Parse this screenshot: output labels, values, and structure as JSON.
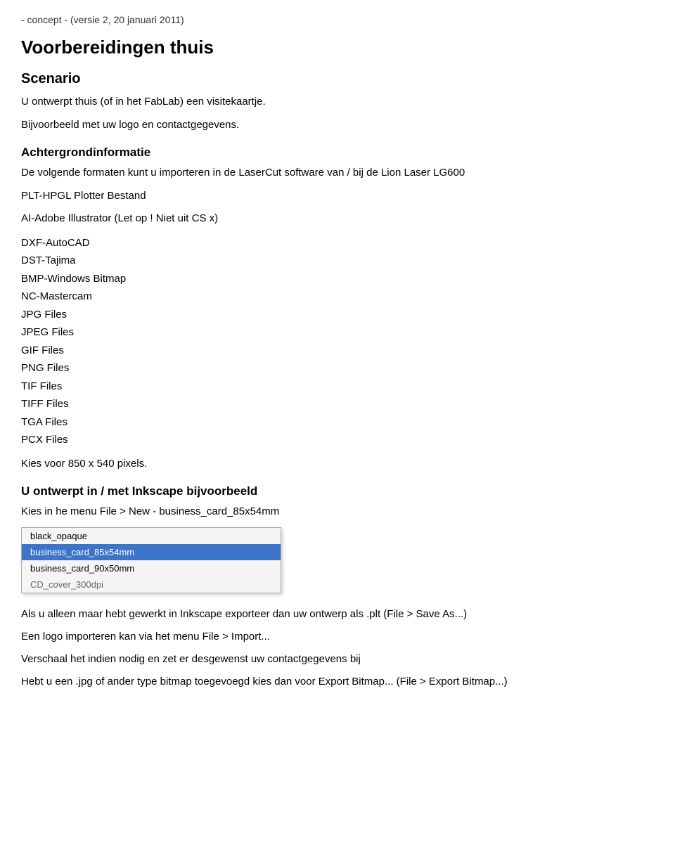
{
  "version_line": "- concept - (versie 2, 20 januari 2011)",
  "main_heading": "Voorbereidingen thuis",
  "scenario_heading": "Scenario",
  "scenario_text": "U ontwerpt thuis (of in het FabLab) een visitekaartje.",
  "scenario_subtext": "Bijvoorbeeld met uw logo en contactgegevens.",
  "background_heading": "Achtergrondinformatie",
  "background_intro": "De volgende formaten kunt u importeren in de LaserCut software van / bij de Lion Laser LG600",
  "plt_hpgl": "PLT-HPGL Plotter Bestand",
  "ai_adobe": "AI-Adobe Illustrator (Let op !",
  "ai_note": "Niet uit CS x)",
  "formats": [
    "DXF-AutoCAD",
    "DST-Tajima",
    "BMP-Windows Bitmap",
    "NC-Mastercam",
    "JPG Files",
    "JPEG Files",
    "GIF Files",
    "PNG Files",
    "TIF Files",
    "TIFF Files",
    "TGA Files",
    "PCX Files"
  ],
  "pixels_note": "Kies voor 850 x 540 pixels.",
  "inkscape_heading": "U ontwerpt in / met Inkscape bijvoorbeeld",
  "inkscape_menu_label": "Kies in he menu File > New - business_card_85x54mm",
  "menu_items": [
    {
      "label": "black_opaque",
      "selected": false
    },
    {
      "label": "business_card_85x54mm",
      "selected": true
    },
    {
      "label": "business_card_90x50mm",
      "selected": false
    },
    {
      "label": "CD_cover_300dpi",
      "selected": false,
      "partial": true
    }
  ],
  "export_note": "Als u alleen maar hebt gewerkt in Inkscape exporteer dan uw ontwerp als .plt (File > Save As...)",
  "import_note": "Een logo importeren kan via het menu File > Import...",
  "rescale_note": "Verschaal het indien nodig en zet er desgewenst uw contactgegevens bij",
  "bitmap_note": "Hebt u een .jpg of ander type bitmap toegevoegd kies dan voor Export Bitmap... (File > Export Bitmap...)"
}
